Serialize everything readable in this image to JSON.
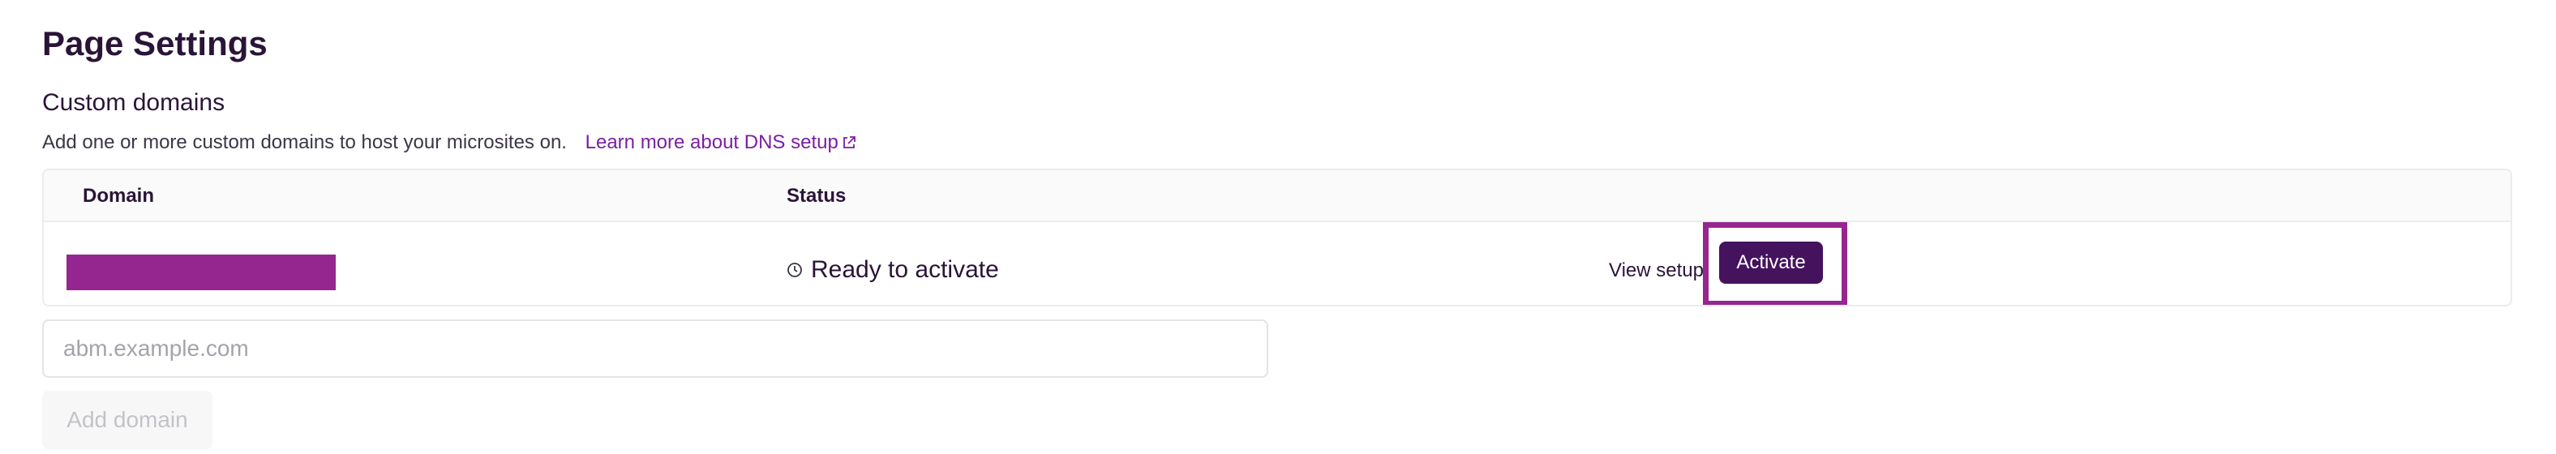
{
  "page": {
    "title": "Page Settings"
  },
  "custom_domains": {
    "title": "Custom domains",
    "description": "Add one or more custom domains to host your microsites on.",
    "learn_more_link": "Learn more about DNS setup",
    "learn_more_icon": "external-link-icon",
    "table": {
      "columns": [
        "Domain",
        "Status"
      ],
      "rows": [
        {
          "domain_redacted": true,
          "status_icon": "clock-icon",
          "status": "Ready to activate",
          "view_setup_label": "View setup",
          "activate_label": "Activate"
        }
      ]
    },
    "input": {
      "placeholder": "abm.example.com",
      "value": ""
    },
    "add_button_label": "Add domain"
  },
  "colors": {
    "accent": "#7b1fa2",
    "primary_button": "#45125e",
    "highlight": "#96268f",
    "redaction": "#96268f"
  }
}
